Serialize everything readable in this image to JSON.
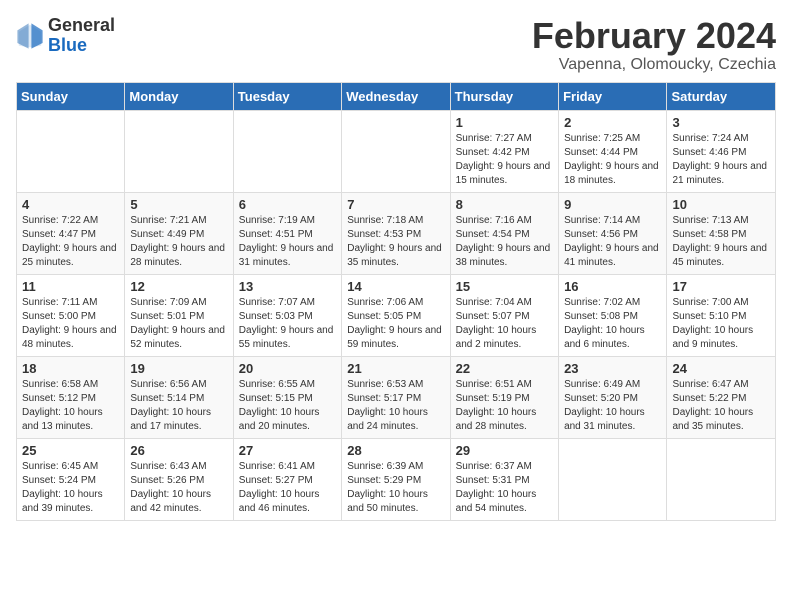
{
  "header": {
    "logo_general": "General",
    "logo_blue": "Blue",
    "month_year": "February 2024",
    "location": "Vapenna, Olomoucky, Czechia"
  },
  "days_of_week": [
    "Sunday",
    "Monday",
    "Tuesday",
    "Wednesday",
    "Thursday",
    "Friday",
    "Saturday"
  ],
  "weeks": [
    [
      {
        "day": "",
        "info": ""
      },
      {
        "day": "",
        "info": ""
      },
      {
        "day": "",
        "info": ""
      },
      {
        "day": "",
        "info": ""
      },
      {
        "day": "1",
        "info": "Sunrise: 7:27 AM\nSunset: 4:42 PM\nDaylight: 9 hours and 15 minutes."
      },
      {
        "day": "2",
        "info": "Sunrise: 7:25 AM\nSunset: 4:44 PM\nDaylight: 9 hours and 18 minutes."
      },
      {
        "day": "3",
        "info": "Sunrise: 7:24 AM\nSunset: 4:46 PM\nDaylight: 9 hours and 21 minutes."
      }
    ],
    [
      {
        "day": "4",
        "info": "Sunrise: 7:22 AM\nSunset: 4:47 PM\nDaylight: 9 hours and 25 minutes."
      },
      {
        "day": "5",
        "info": "Sunrise: 7:21 AM\nSunset: 4:49 PM\nDaylight: 9 hours and 28 minutes."
      },
      {
        "day": "6",
        "info": "Sunrise: 7:19 AM\nSunset: 4:51 PM\nDaylight: 9 hours and 31 minutes."
      },
      {
        "day": "7",
        "info": "Sunrise: 7:18 AM\nSunset: 4:53 PM\nDaylight: 9 hours and 35 minutes."
      },
      {
        "day": "8",
        "info": "Sunrise: 7:16 AM\nSunset: 4:54 PM\nDaylight: 9 hours and 38 minutes."
      },
      {
        "day": "9",
        "info": "Sunrise: 7:14 AM\nSunset: 4:56 PM\nDaylight: 9 hours and 41 minutes."
      },
      {
        "day": "10",
        "info": "Sunrise: 7:13 AM\nSunset: 4:58 PM\nDaylight: 9 hours and 45 minutes."
      }
    ],
    [
      {
        "day": "11",
        "info": "Sunrise: 7:11 AM\nSunset: 5:00 PM\nDaylight: 9 hours and 48 minutes."
      },
      {
        "day": "12",
        "info": "Sunrise: 7:09 AM\nSunset: 5:01 PM\nDaylight: 9 hours and 52 minutes."
      },
      {
        "day": "13",
        "info": "Sunrise: 7:07 AM\nSunset: 5:03 PM\nDaylight: 9 hours and 55 minutes."
      },
      {
        "day": "14",
        "info": "Sunrise: 7:06 AM\nSunset: 5:05 PM\nDaylight: 9 hours and 59 minutes."
      },
      {
        "day": "15",
        "info": "Sunrise: 7:04 AM\nSunset: 5:07 PM\nDaylight: 10 hours and 2 minutes."
      },
      {
        "day": "16",
        "info": "Sunrise: 7:02 AM\nSunset: 5:08 PM\nDaylight: 10 hours and 6 minutes."
      },
      {
        "day": "17",
        "info": "Sunrise: 7:00 AM\nSunset: 5:10 PM\nDaylight: 10 hours and 9 minutes."
      }
    ],
    [
      {
        "day": "18",
        "info": "Sunrise: 6:58 AM\nSunset: 5:12 PM\nDaylight: 10 hours and 13 minutes."
      },
      {
        "day": "19",
        "info": "Sunrise: 6:56 AM\nSunset: 5:14 PM\nDaylight: 10 hours and 17 minutes."
      },
      {
        "day": "20",
        "info": "Sunrise: 6:55 AM\nSunset: 5:15 PM\nDaylight: 10 hours and 20 minutes."
      },
      {
        "day": "21",
        "info": "Sunrise: 6:53 AM\nSunset: 5:17 PM\nDaylight: 10 hours and 24 minutes."
      },
      {
        "day": "22",
        "info": "Sunrise: 6:51 AM\nSunset: 5:19 PM\nDaylight: 10 hours and 28 minutes."
      },
      {
        "day": "23",
        "info": "Sunrise: 6:49 AM\nSunset: 5:20 PM\nDaylight: 10 hours and 31 minutes."
      },
      {
        "day": "24",
        "info": "Sunrise: 6:47 AM\nSunset: 5:22 PM\nDaylight: 10 hours and 35 minutes."
      }
    ],
    [
      {
        "day": "25",
        "info": "Sunrise: 6:45 AM\nSunset: 5:24 PM\nDaylight: 10 hours and 39 minutes."
      },
      {
        "day": "26",
        "info": "Sunrise: 6:43 AM\nSunset: 5:26 PM\nDaylight: 10 hours and 42 minutes."
      },
      {
        "day": "27",
        "info": "Sunrise: 6:41 AM\nSunset: 5:27 PM\nDaylight: 10 hours and 46 minutes."
      },
      {
        "day": "28",
        "info": "Sunrise: 6:39 AM\nSunset: 5:29 PM\nDaylight: 10 hours and 50 minutes."
      },
      {
        "day": "29",
        "info": "Sunrise: 6:37 AM\nSunset: 5:31 PM\nDaylight: 10 hours and 54 minutes."
      },
      {
        "day": "",
        "info": ""
      },
      {
        "day": "",
        "info": ""
      }
    ]
  ]
}
